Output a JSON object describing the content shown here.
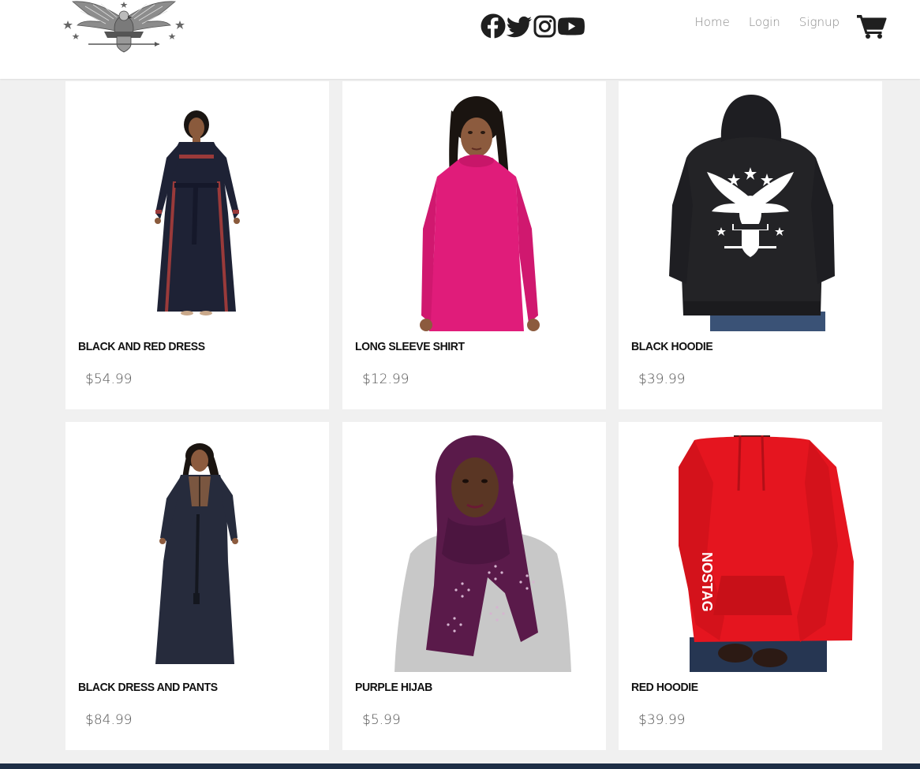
{
  "brand": {
    "logo_icon": "eagle-crest-logo"
  },
  "social": [
    {
      "name": "facebook",
      "icon": "facebook-icon"
    },
    {
      "name": "twitter",
      "icon": "twitter-icon"
    },
    {
      "name": "instagram",
      "icon": "instagram-icon"
    },
    {
      "name": "youtube",
      "icon": "youtube-icon"
    }
  ],
  "nav": {
    "home": "Home",
    "login": "Login",
    "signup": "Signup",
    "cart_icon": "shopping-cart-icon"
  },
  "products": [
    {
      "name": "Black and Red Dress",
      "price": "$54.99",
      "image": "black-red-dress-photo"
    },
    {
      "name": "Long Sleeve Shirt",
      "price": "$12.99",
      "image": "pink-long-sleeve-shirt-photo"
    },
    {
      "name": "Black Hoodie",
      "price": "$39.99",
      "image": "black-hoodie-photo"
    },
    {
      "name": "Black Dress and Pants",
      "price": "$84.99",
      "image": "black-dress-pants-photo"
    },
    {
      "name": "Purple Hijab",
      "price": "$5.99",
      "image": "purple-hijab-photo"
    },
    {
      "name": "Red Hoodie",
      "price": "$39.99",
      "image": "red-hoodie-photo"
    }
  ],
  "colors": {
    "page_bg": "#f0f0f0",
    "card_bg": "#ffffff",
    "nav_text": "#8a8a8a",
    "title_text": "#111111",
    "price_text": "#555555",
    "footer": "#1e2e46"
  }
}
